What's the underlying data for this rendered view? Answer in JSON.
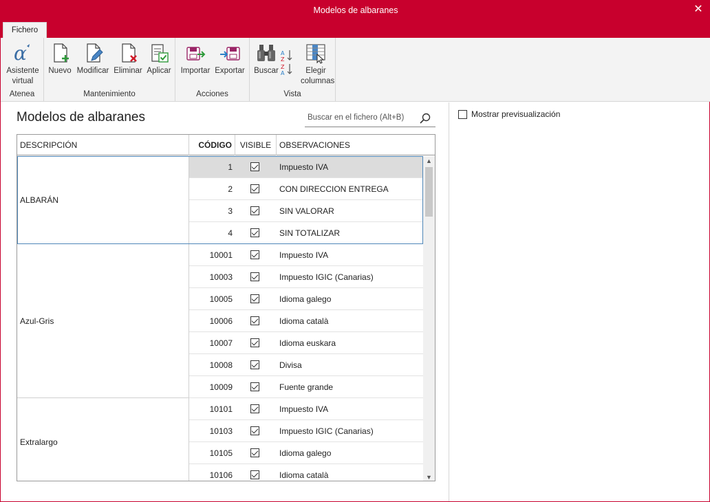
{
  "window": {
    "title": "Modelos de albaranes",
    "close_glyph": "✕",
    "accent_color": "#c8002d"
  },
  "tabs": [
    {
      "label": "Fichero",
      "active": true
    }
  ],
  "ribbon": {
    "groups": [
      {
        "label": "Atenea",
        "buttons": [
          {
            "label": "Asistente virtual",
            "icon": "alpha-assistant-icon"
          }
        ]
      },
      {
        "label": "Mantenimiento",
        "buttons": [
          {
            "label": "Nuevo",
            "icon": "new-document-icon"
          },
          {
            "label": "Modificar",
            "icon": "edit-document-icon"
          },
          {
            "label": "Eliminar",
            "icon": "delete-document-icon"
          },
          {
            "label": "Aplicar",
            "icon": "apply-checklist-icon"
          }
        ]
      },
      {
        "label": "Acciones",
        "buttons": [
          {
            "label": "Importar",
            "icon": "import-icon"
          },
          {
            "label": "Exportar",
            "icon": "export-icon"
          }
        ]
      },
      {
        "label": "Vista",
        "buttons": [
          {
            "label": "Buscar",
            "icon": "binoculars-icon"
          },
          {
            "label": "",
            "icon": "sort-az-icon"
          },
          {
            "label": "Elegir columnas",
            "icon": "choose-columns-icon"
          }
        ]
      }
    ]
  },
  "main": {
    "title": "Modelos de albaranes",
    "search": {
      "placeholder": "Buscar en el fichero (Alt+B)",
      "value": ""
    }
  },
  "table": {
    "columns": [
      "DESCRIPCIÓN",
      "CÓDIGO",
      "VISIBLE",
      "OBSERVACIONES"
    ],
    "groups": [
      {
        "name": "ALBARÁN",
        "rows": [
          {
            "code": "1",
            "visible": true,
            "obs": "Impuesto IVA"
          },
          {
            "code": "2",
            "visible": true,
            "obs": "CON DIRECCION ENTREGA"
          },
          {
            "code": "3",
            "visible": true,
            "obs": "SIN VALORAR"
          },
          {
            "code": "4",
            "visible": true,
            "obs": "SIN TOTALIZAR"
          }
        ]
      },
      {
        "name": "Azul-Gris",
        "rows": [
          {
            "code": "10001",
            "visible": true,
            "obs": "Impuesto IVA"
          },
          {
            "code": "10003",
            "visible": true,
            "obs": "Impuesto IGIC (Canarias)"
          },
          {
            "code": "10005",
            "visible": true,
            "obs": "Idioma galego"
          },
          {
            "code": "10006",
            "visible": true,
            "obs": "Idioma català"
          },
          {
            "code": "10007",
            "visible": true,
            "obs": "Idioma euskara"
          },
          {
            "code": "10008",
            "visible": true,
            "obs": "Divisa"
          },
          {
            "code": "10009",
            "visible": true,
            "obs": "Fuente grande"
          }
        ]
      },
      {
        "name": "Extralargo",
        "rows": [
          {
            "code": "10101",
            "visible": true,
            "obs": "Impuesto IVA"
          },
          {
            "code": "10103",
            "visible": true,
            "obs": "Impuesto IGIC (Canarias)"
          },
          {
            "code": "10105",
            "visible": true,
            "obs": "Idioma galego"
          },
          {
            "code": "10106",
            "visible": true,
            "obs": "Idioma català"
          }
        ]
      }
    ],
    "selected_code": "1"
  },
  "preview": {
    "label": "Mostrar previsualización",
    "checked": false
  }
}
